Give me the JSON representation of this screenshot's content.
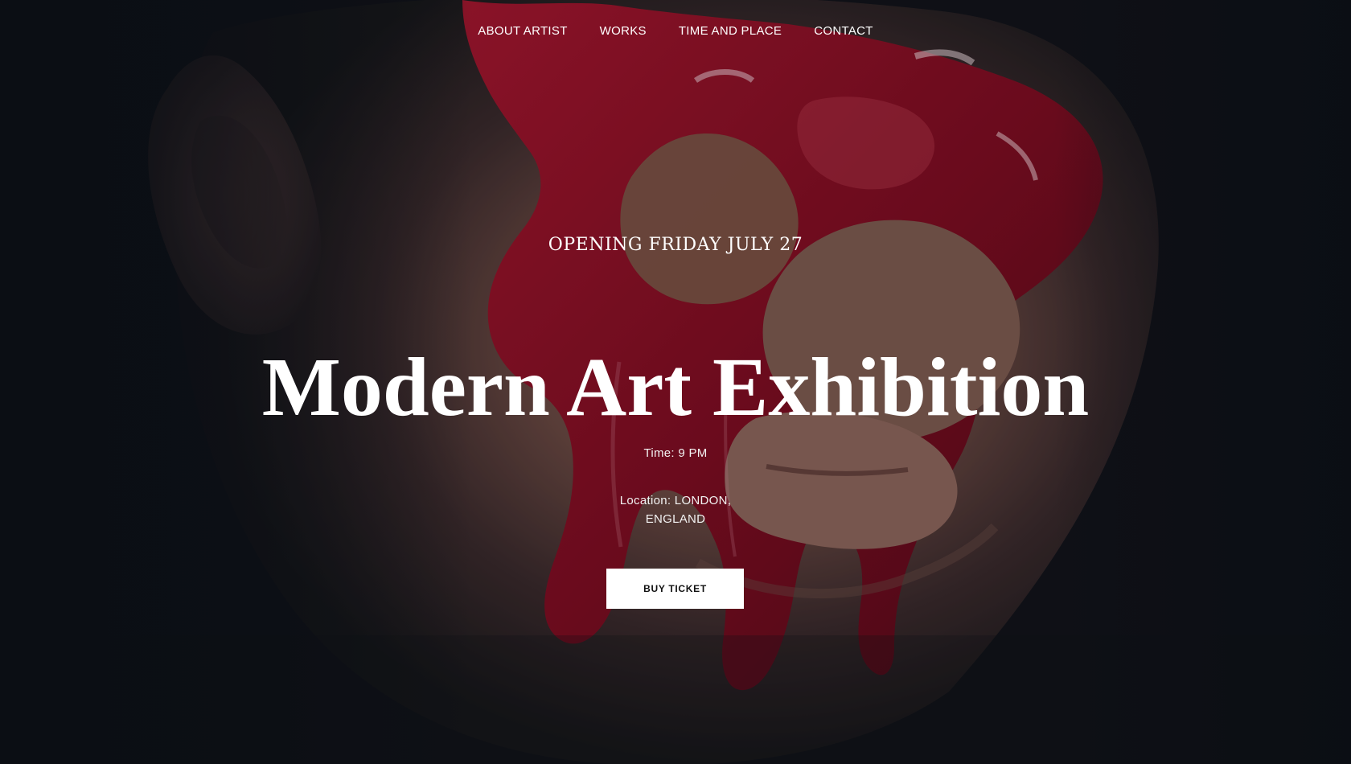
{
  "nav": {
    "items": [
      {
        "label": "ABOUT ARTIST"
      },
      {
        "label": "WORKS"
      },
      {
        "label": "TIME AND PLACE"
      },
      {
        "label": "CONTACT"
      }
    ]
  },
  "hero": {
    "eyebrow": "OPENING FRIDAY JULY 27",
    "title": "Modern Art Exhibition",
    "time": "Time: 9 PM",
    "location_line1": "Location: LONDON,",
    "location_line2": "ENGLAND",
    "button_label": "BUY TICKET"
  },
  "colors": {
    "background": "#0d1117",
    "paint_red": "#8f0f25",
    "skin": "#8b6558",
    "text": "#ffffff",
    "button_bg": "#ffffff",
    "button_text": "#111111"
  }
}
